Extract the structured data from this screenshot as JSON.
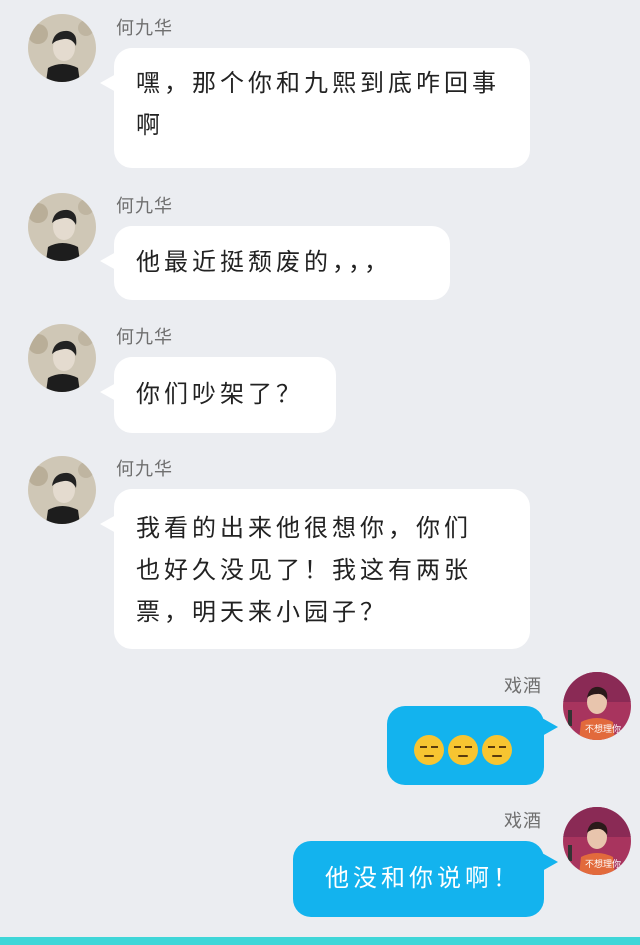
{
  "messages": [
    {
      "sender": "何九华",
      "text": "嘿，那个你和九熙到底咋回事啊"
    },
    {
      "sender": "何九华",
      "text": "他最近挺颓废的，，，"
    },
    {
      "sender": "何九华",
      "text": "你们吵架了？"
    },
    {
      "sender": "何九华",
      "text_lines": [
        "我看的出来他很想你，你们",
        "也好久没见了！我这有两张",
        "票，明天来小园子？"
      ]
    },
    {
      "sender": "戏酒",
      "emoji": [
        "unamused-face-icon",
        "unamused-face-icon",
        "unamused-face-icon"
      ]
    },
    {
      "sender": "戏酒",
      "text": "他没和你说啊！"
    }
  ],
  "self_avatar_caption": "不想理你",
  "colors": {
    "background": "#ebedf1",
    "incoming_bubble": "#ffffff",
    "outgoing_bubble": "#13b3ee",
    "bottom_bar": "#3ed6d8"
  }
}
